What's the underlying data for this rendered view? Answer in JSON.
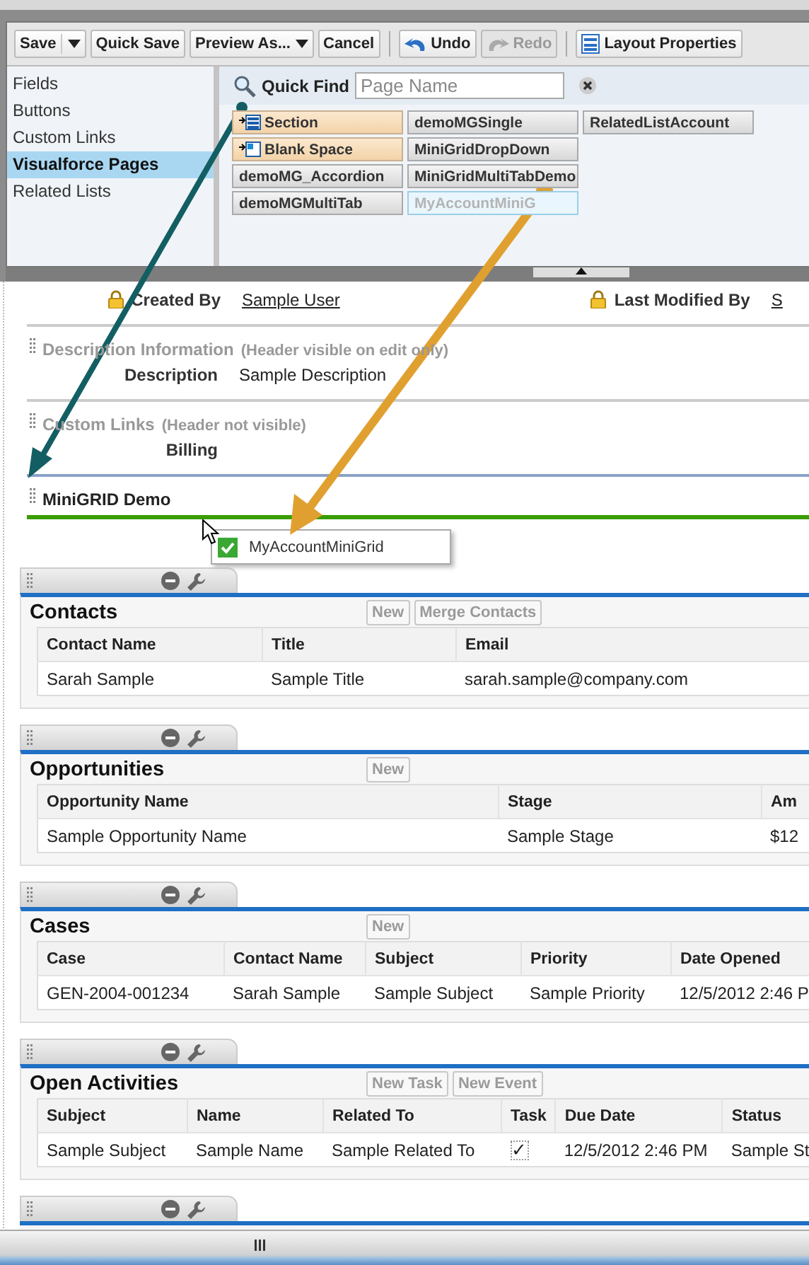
{
  "toolbar": {
    "buttons": [
      {
        "label": "Save",
        "kind": "split",
        "disabled": false
      },
      {
        "label": "Quick Save",
        "kind": "plain",
        "disabled": false
      },
      {
        "label": "Preview As...",
        "kind": "dropdown",
        "disabled": false
      },
      {
        "label": "Cancel",
        "kind": "plain",
        "disabled": false
      },
      {
        "label": "Undo",
        "kind": "undo",
        "disabled": false
      },
      {
        "label": "Redo",
        "kind": "redo",
        "disabled": true
      },
      {
        "label": "Layout Properties",
        "kind": "layout",
        "disabled": false
      }
    ]
  },
  "palette": {
    "categories": [
      {
        "label": "Fields",
        "selected": false
      },
      {
        "label": "Buttons",
        "selected": false
      },
      {
        "label": "Custom Links",
        "selected": false
      },
      {
        "label": "Visualforce Pages",
        "selected": true
      },
      {
        "label": "Related Lists",
        "selected": false
      }
    ],
    "quick_find": {
      "label": "Quick Find",
      "placeholder": "Page Name"
    },
    "items": [
      {
        "label": "Section",
        "kind": "section",
        "disabled": false
      },
      {
        "label": "Blank Space",
        "kind": "blank",
        "disabled": false
      },
      {
        "label": "demoMG_Accordion",
        "kind": "page",
        "disabled": false
      },
      {
        "label": "demoMGMultiTab",
        "kind": "page",
        "disabled": false
      },
      {
        "label": "demoMGSingle",
        "kind": "page",
        "disabled": false
      },
      {
        "label": "MiniGridDropDown",
        "kind": "page",
        "disabled": false
      },
      {
        "label": "MiniGridMultiTabDemo",
        "kind": "page",
        "disabled": false
      },
      {
        "label": "MyAccountMiniG",
        "kind": "page",
        "disabled": true
      },
      {
        "label": "RelatedListAccount",
        "kind": "page",
        "disabled": false
      }
    ]
  },
  "system_info": {
    "fields": [
      {
        "label": "Created By",
        "value": "Sample User",
        "locked": true
      },
      {
        "label": "Last Modified By",
        "value": "S",
        "locked": true
      }
    ]
  },
  "sections": [
    {
      "title": "Description Information",
      "note": "(Header visible on edit only)",
      "dimmed": true,
      "drop_target": false,
      "fields": [
        {
          "label": "Description",
          "value": "Sample Description"
        }
      ]
    },
    {
      "title": "Custom Links",
      "note": "(Header not visible)",
      "dimmed": true,
      "drop_target": false,
      "fields": [
        {
          "label": "Billing"
        }
      ]
    },
    {
      "title": "MiniGRID Demo",
      "dimmed": false,
      "drop_target": true
    }
  ],
  "drag_item": {
    "label": "MyAccountMiniGrid"
  },
  "related_lists": [
    {
      "kind": "full",
      "title": "Contacts",
      "buttons": [
        "New",
        "Merge Contacts"
      ],
      "columns": [
        "Contact Name",
        "Title",
        "Email"
      ],
      "rows": [
        [
          "Sarah Sample",
          "Sample Title",
          "sarah.sample@company.com"
        ]
      ]
    },
    {
      "kind": "full",
      "title": "Opportunities",
      "buttons": [
        "New"
      ],
      "columns": [
        "Opportunity Name",
        "Stage",
        "Am"
      ],
      "rows": [
        [
          "Sample Opportunity Name",
          "Sample Stage",
          "$12"
        ]
      ]
    },
    {
      "kind": "full",
      "title": "Cases",
      "buttons": [
        "New"
      ],
      "columns": [
        "Case",
        "Contact Name",
        "Subject",
        "Priority",
        "Date Opened"
      ],
      "rows": [
        [
          "GEN-2004-001234",
          "Sarah Sample",
          "Sample Subject",
          "Sample Priority",
          "12/5/2012 2:46 P"
        ]
      ]
    },
    {
      "kind": "full",
      "title": "Open Activities",
      "buttons": [
        "New Task",
        "New Event"
      ],
      "columns": [
        "Subject",
        "Name",
        "Related To",
        "Task",
        "Due Date",
        "Status"
      ],
      "rows": [
        [
          "Sample Subject",
          "Sample Name",
          "Sample Related To",
          "✓",
          "12/5/2012 2:46 PM",
          "Sample St"
        ]
      ]
    },
    {
      "kind": "cut"
    }
  ]
}
